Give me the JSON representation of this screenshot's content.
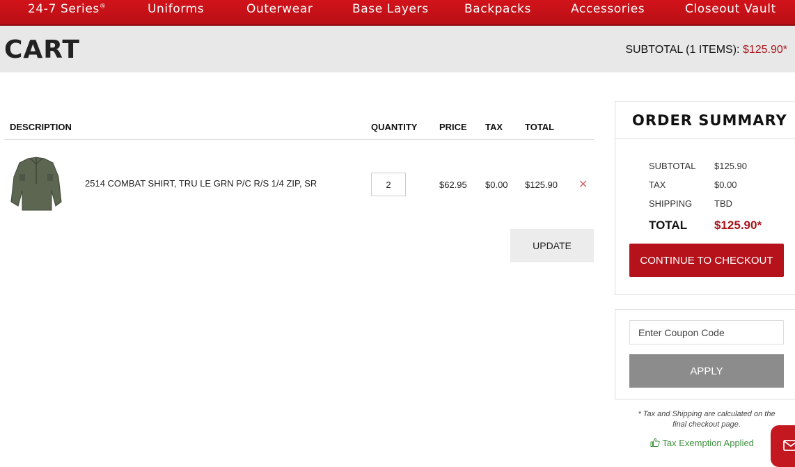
{
  "nav": {
    "items": [
      "24-7 Series",
      "Uniforms",
      "Outerwear",
      "Base Layers",
      "Backpacks",
      "Accessories",
      "Closeout Vault"
    ],
    "registered_mark": "®"
  },
  "cart": {
    "title": "CART",
    "subtotal_label": "SUBTOTAL (1 ITEMS):",
    "subtotal_value": "$125.90*"
  },
  "table": {
    "headers": [
      "DESCRIPTION",
      "QUANTITY",
      "PRICE",
      "TAX",
      "TOTAL"
    ],
    "items": [
      {
        "description": "2514 COMBAT SHIRT, TRU LE GRN P/C R/S 1/4 ZIP, SR",
        "quantity": "2",
        "price": "$62.95",
        "tax": "$0.00",
        "total": "$125.90",
        "remove_icon": "close-icon"
      }
    ],
    "update_label": "UPDATE"
  },
  "summary": {
    "title": "ORDER SUMMARY",
    "rows": [
      {
        "label": "SUBTOTAL",
        "value": "$125.90"
      },
      {
        "label": "TAX",
        "value": "$0.00"
      },
      {
        "label": "SHIPPING",
        "value": "TBD"
      }
    ],
    "total_label": "TOTAL",
    "total_value": "$125.90*",
    "checkout_label": "CONTINUE TO CHECKOUT"
  },
  "coupon": {
    "placeholder": "Enter Coupon Code",
    "apply_label": "APPLY"
  },
  "footer": {
    "note": "* Tax and Shipping are calculated on the final checkout page.",
    "tax_exempt": "Tax Exemption Applied"
  },
  "colors": {
    "brand_red": "#b5121b",
    "price_red": "#a8141a",
    "exempt_green": "#3d8f3d"
  }
}
